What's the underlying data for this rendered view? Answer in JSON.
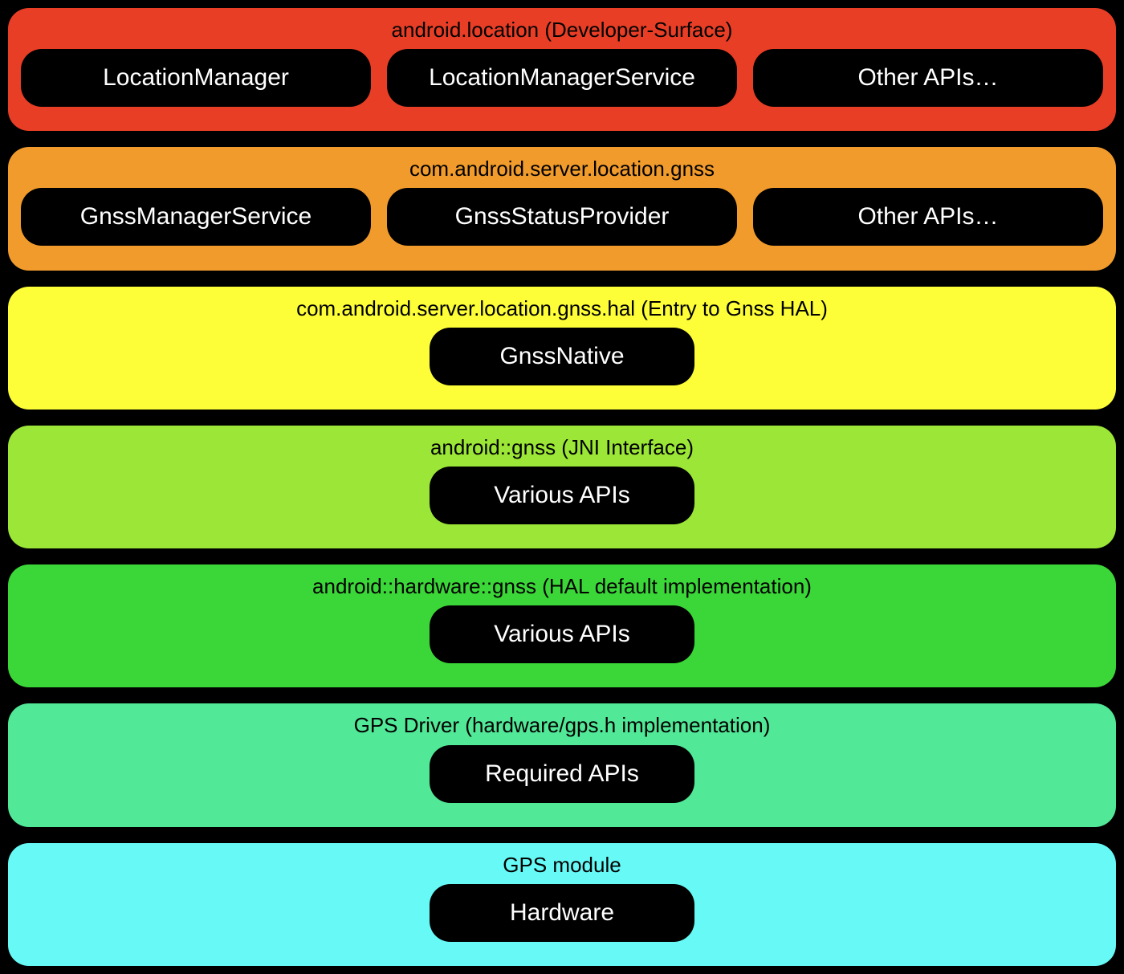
{
  "layers": [
    {
      "title": "android.location (Developer-Surface)",
      "color": "#E83E26",
      "mode": "triple",
      "items": [
        "LocationManager",
        "LocationManagerService",
        "Other APIs…"
      ]
    },
    {
      "title": "com.android.server.location.gnss",
      "color": "#F19B2C",
      "mode": "triple",
      "items": [
        "GnssManagerService",
        "GnssStatusProvider",
        "Other APIs…"
      ]
    },
    {
      "title": "com.android.server.location.gnss.hal (Entry to Gnss HAL)",
      "color": "#FDFD38",
      "mode": "single",
      "items": [
        "GnssNative"
      ]
    },
    {
      "title": "android::gnss (JNI Interface)",
      "color": "#9BE636",
      "mode": "single",
      "items": [
        "Various APIs"
      ]
    },
    {
      "title": "android::hardware::gnss (HAL default implementation)",
      "color": "#3BD738",
      "mode": "single",
      "items": [
        "Various APIs"
      ]
    },
    {
      "title": "GPS Driver (hardware/gps.h implementation)",
      "color": "#51E897",
      "mode": "single",
      "items": [
        "Required APIs"
      ]
    },
    {
      "title": "GPS module",
      "color": "#67F9F6",
      "mode": "single",
      "items": [
        "Hardware"
      ]
    }
  ]
}
